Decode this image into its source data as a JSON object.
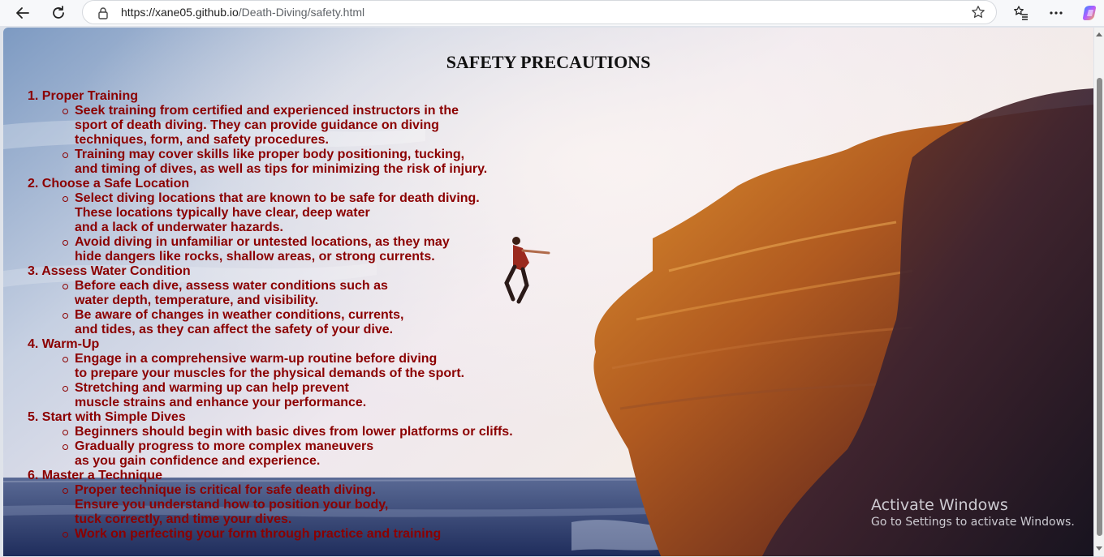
{
  "browser": {
    "url_host": "https://xane05.github.io",
    "url_path": "/Death-Diving/safety.html"
  },
  "page": {
    "title": "SAFETY PRECAUTIONS",
    "sections": [
      {
        "heading": "1. Proper Training",
        "items": [
          [
            "Seek training from certified and experienced instructors in the",
            "sport of death diving. They can provide guidance on diving",
            "techniques, form, and safety procedures."
          ],
          [
            "Training may cover skills like proper body positioning, tucking,",
            "and timing of dives, as well as tips for minimizing the risk of injury."
          ]
        ]
      },
      {
        "heading": "2. Choose a Safe Location",
        "items": [
          [
            "Select diving locations that are known to be safe for death diving.",
            "These locations typically have clear, deep water",
            "and a lack of underwater hazards."
          ],
          [
            "Avoid diving in unfamiliar or untested locations, as they may",
            "hide dangers like rocks, shallow areas, or strong currents."
          ]
        ]
      },
      {
        "heading": "3. Assess Water Condition",
        "items": [
          [
            "Before each dive, assess water conditions such as",
            "water depth, temperature, and visibility."
          ],
          [
            "Be aware of changes in weather conditions, currents,",
            "and tides, as they can affect the safety of your dive."
          ]
        ]
      },
      {
        "heading": "4. Warm-Up",
        "items": [
          [
            "Engage in a comprehensive warm-up routine before diving",
            "to prepare your muscles for the physical demands of the sport."
          ],
          [
            "Stretching and warming up can help prevent",
            "muscle strains and enhance your performance."
          ]
        ]
      },
      {
        "heading": "5. Start with Simple Dives",
        "items": [
          [
            "Beginners should begin with basic dives from lower platforms or cliffs."
          ],
          [
            "Gradually progress to more complex maneuvers",
            "as you gain confidence and experience."
          ]
        ]
      },
      {
        "heading": "6. Master a Technique",
        "items": [
          [
            "Proper technique is critical for safe death diving.",
            "Ensure you understand how to position your body,",
            "tuck correctly, and time your dives."
          ],
          [
            "Work on perfecting your form through practice and training"
          ]
        ]
      }
    ]
  },
  "watermark": {
    "line1": "Activate Windows",
    "line2": "Go to Settings to activate Windows."
  },
  "colors": {
    "text": "#8b0000",
    "title": "#111111"
  }
}
